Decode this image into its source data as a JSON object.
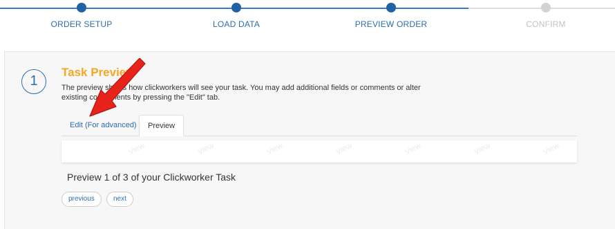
{
  "stepper": {
    "steps": [
      {
        "label": "ORDER SETUP",
        "state": "done"
      },
      {
        "label": "LOAD DATA",
        "state": "done"
      },
      {
        "label": "PREVIEW ORDER",
        "state": "done"
      },
      {
        "label": "CONFIRM",
        "state": "todo"
      }
    ]
  },
  "panel": {
    "step_number": "1",
    "title": "Task Preview",
    "description": "The preview shows how clickworkers will see your task. You may add additional fields or comments or alter existing components by pressing the \"Edit\" tab.",
    "tabs": [
      {
        "label": "Edit (For advanced)",
        "active": false
      },
      {
        "label": "Preview",
        "active": true
      }
    ],
    "watermark": "view",
    "preview_caption": "Preview 1 of 3 of your Clickworker Task",
    "buttons": {
      "previous": "previous",
      "next": "next"
    }
  },
  "annotation": {
    "icon": "red-arrow-icon",
    "color": "#e8231c"
  },
  "colors": {
    "accent": "#2a6eb0",
    "title": "#f5a623",
    "inactive": "#c2c2c2"
  }
}
